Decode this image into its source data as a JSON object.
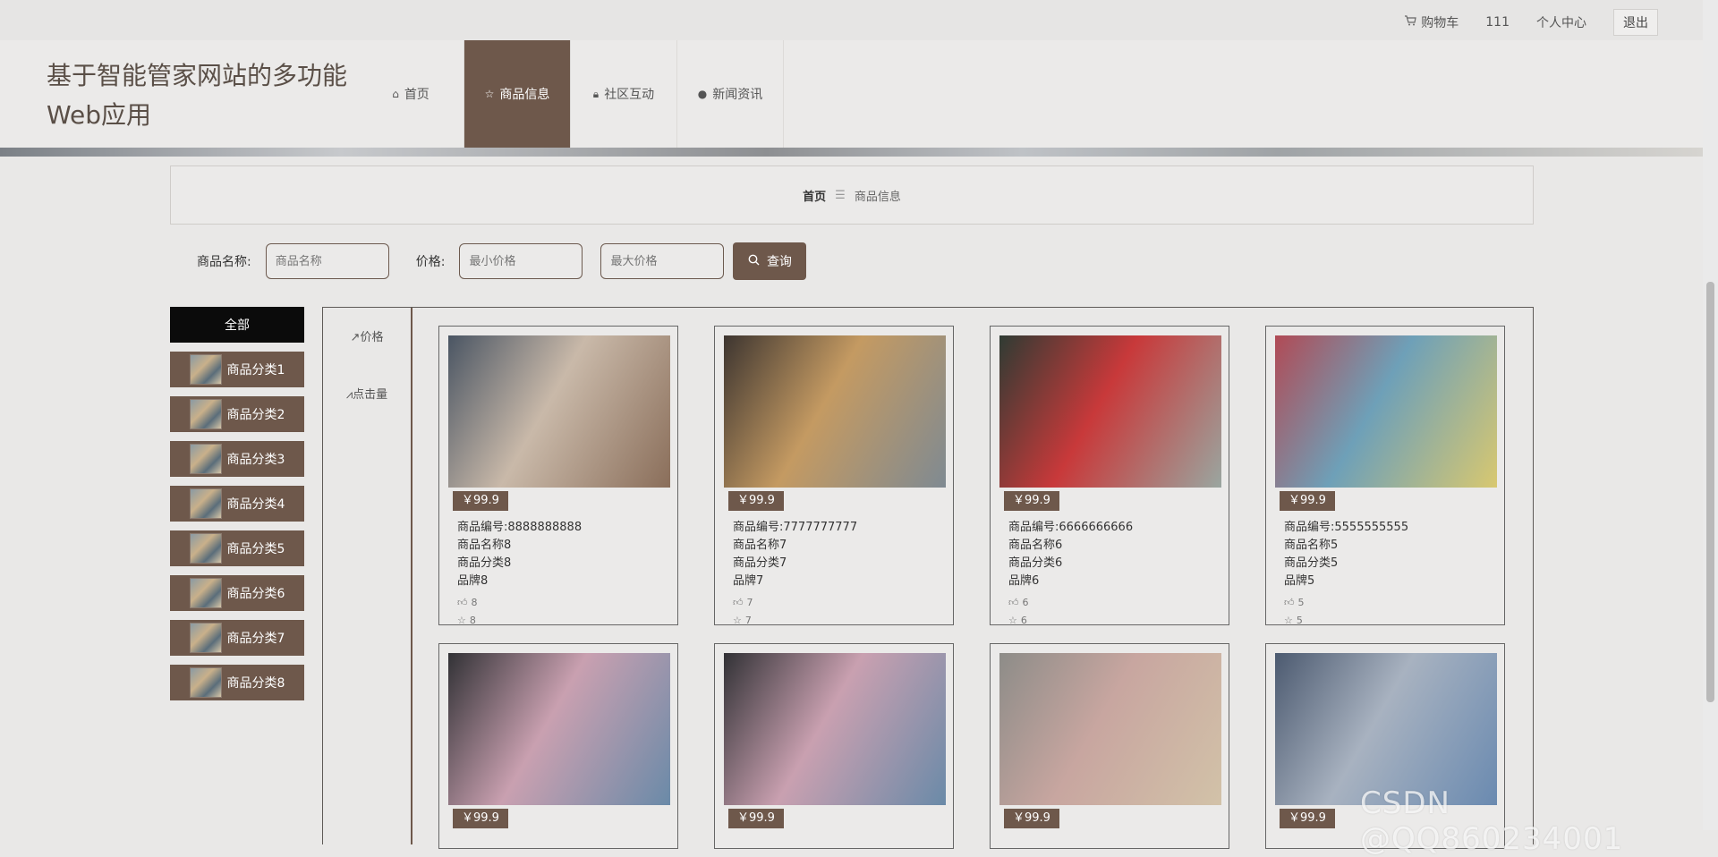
{
  "topbar": {
    "cart_label": "购物车",
    "username": "111",
    "profile_label": "个人中心",
    "logout_label": "退出"
  },
  "site": {
    "title_line1": "基于智能管家网站的多功能",
    "title_line2": "Web应用"
  },
  "nav": [
    {
      "label": "首页",
      "icon": "home-icon"
    },
    {
      "label": "商品信息",
      "icon": "star-icon"
    },
    {
      "label": "社区互动",
      "icon": "lock-icon"
    },
    {
      "label": "新闻资讯",
      "icon": "info-icon"
    }
  ],
  "breadcrumb": {
    "home": "首页",
    "separator": "☰",
    "current": "商品信息"
  },
  "search": {
    "name_label": "商品名称:",
    "name_placeholder": "商品名称",
    "price_label": "价格:",
    "min_placeholder": "最小价格",
    "max_placeholder": "最大价格",
    "button_label": "查询"
  },
  "categories": [
    "全部",
    "商品分类1",
    "商品分类2",
    "商品分类3",
    "商品分类4",
    "商品分类5",
    "商品分类6",
    "商品分类7",
    "商品分类8"
  ],
  "sort": {
    "price_label": "价格",
    "clicks_label": "点击量"
  },
  "products": [
    {
      "price": "￥99.9",
      "code": "商品编号:8888888888",
      "name": "商品名称8",
      "category": "商品分类8",
      "brand": "品牌8",
      "likes": "8",
      "favs": "8",
      "colors": [
        "#4a5563",
        "#c9b9a9",
        "#8a6e5a"
      ]
    },
    {
      "price": "￥99.9",
      "code": "商品编号:7777777777",
      "name": "商品名称7",
      "category": "商品分类7",
      "brand": "品牌7",
      "likes": "7",
      "favs": "7",
      "colors": [
        "#3d3530",
        "#c49a62",
        "#7f8a92"
      ]
    },
    {
      "price": "￥99.9",
      "code": "商品编号:6666666666",
      "name": "商品名称6",
      "category": "商品分类6",
      "brand": "品牌6",
      "likes": "6",
      "favs": "6",
      "colors": [
        "#2f3b33",
        "#c8393a",
        "#9aa6a0"
      ]
    },
    {
      "price": "￥99.9",
      "code": "商品编号:5555555555",
      "name": "商品名称5",
      "category": "商品分类5",
      "brand": "品牌5",
      "likes": "5",
      "favs": "5",
      "colors": [
        "#b14a55",
        "#6ea0b8",
        "#d8c870"
      ]
    },
    {
      "price": "￥99.9",
      "colors": [
        "#323236",
        "#c9a0b0",
        "#6a8aa8"
      ]
    },
    {
      "price": "￥99.9",
      "colors": [
        "#323236",
        "#c9a0b0",
        "#6a8aa8"
      ]
    },
    {
      "price": "￥99.9",
      "colors": [
        "#8d8c88",
        "#c8a6a0",
        "#d2c2a8"
      ]
    },
    {
      "price": "￥99.9",
      "colors": [
        "#4c5a70",
        "#a8b2c0",
        "#6a8ab0"
      ]
    }
  ],
  "watermark": "CSDN @QQ860234001"
}
